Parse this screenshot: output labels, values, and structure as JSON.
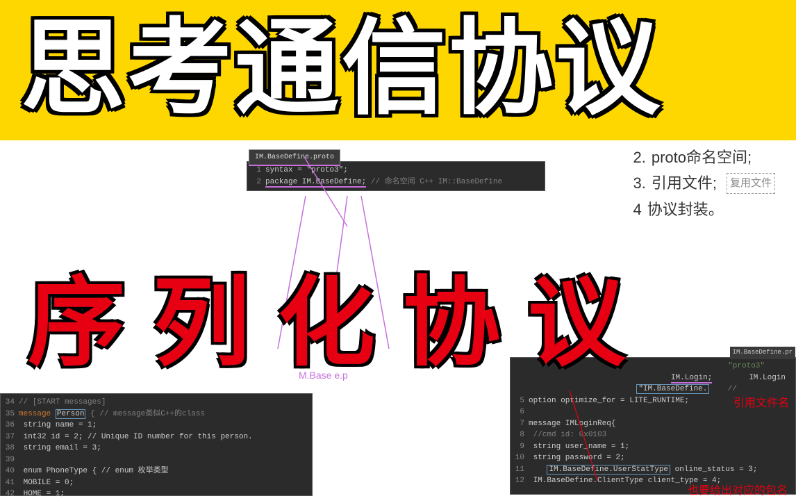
{
  "header": {
    "title": "思考通信协议"
  },
  "subtitle": "序列化协议",
  "notes": {
    "n2": {
      "num": "2.",
      "text": "proto命名空间;"
    },
    "n3": {
      "num": "3.",
      "text": "引用文件;",
      "tag": "复用文件"
    },
    "n4": {
      "num": "4",
      "text": "协议封装。"
    }
  },
  "top_window": {
    "tab": "IM.BaseDefine.proto",
    "line1_num": "1",
    "line1": "syntax = \"proto3\";",
    "line2_num": "2",
    "line2_a": "package IM.BaseDefine;",
    "line2_b": "// 命名空间 C++ IM::BaseDefine"
  },
  "purple_label": "M.Base       e.p",
  "left_window": {
    "l34_num": "34",
    "l34": "// [START messages]",
    "l35_num": "35",
    "l35_a": "message ",
    "l35_person": "Person",
    "l35_b": " {     // message类似C++的class",
    "l36_num": "36",
    "l36": "    string name   = 1;",
    "l37_num": "37",
    "l37": "    int32 id      = 2;  // Unique ID number for this person.",
    "l38_num": "38",
    "l38": "    string email  = 3;",
    "l39_num": "39",
    "l39": "",
    "l40_num": "40",
    "l40": "    enum PhoneType {    // enum 枚举类型",
    "l41_num": "41",
    "l41": "        MOBILE = 0;",
    "l42_num": "42",
    "l42": "        HOME = 1;"
  },
  "right_window": {
    "tab_right": "IM.BaseDefine.pr",
    "l2": "\"proto3\"",
    "l3a": "IM.Login;",
    "l3b": "IM.Login",
    "l4a": "\"IM.BaseDefine.",
    "l4b": "//",
    "l5_num": "5",
    "l5": "option optimize_for = LITE_RUNTIME;",
    "l6_num": "6",
    "l7_num": "7",
    "l7": "message IMLoginReq{",
    "l8_num": "8",
    "l8": "    //cmd id:       0x0103",
    "l9_num": "9",
    "l9": "    string user_name = 1;",
    "l10_num": "10",
    "l10": "    string password  = 2;",
    "l11_num": "11",
    "l11a": "IM.BaseDefine.UserStatType",
    "l11b": " online_status = 3;",
    "l12_num": "12",
    "l12": "    IM.BaseDefine.ClientType client_type = 4;"
  },
  "annotations": {
    "filename": "引用文件名",
    "package": "也要给出对应的包名"
  }
}
